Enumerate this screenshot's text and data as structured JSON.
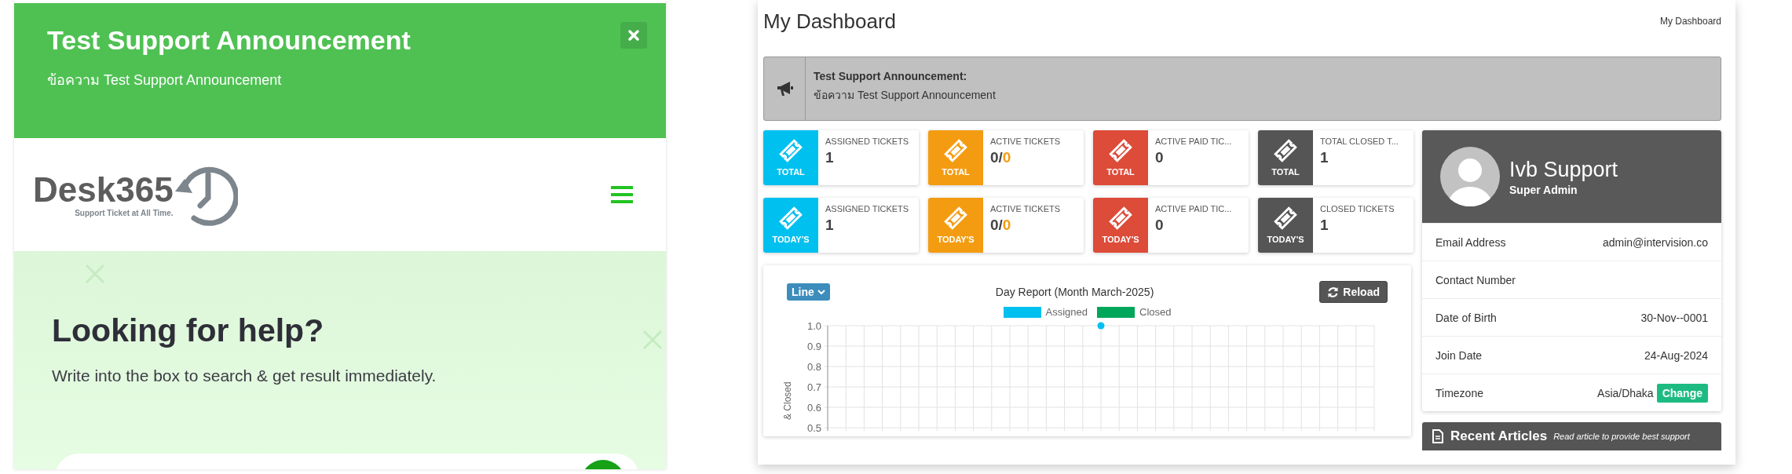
{
  "announcement_popup": {
    "title": "Test Support Announcement",
    "message": "ข้อความ Test Support Announcement"
  },
  "site_header": {
    "logo_text": "Desk365",
    "logo_tagline": "Support Ticket at All Time."
  },
  "hero": {
    "heading": "Looking for help?",
    "subheading": "Write into the box to search & get result immediately."
  },
  "dashboard": {
    "title": "My Dashboard",
    "breadcrumb": "My Dashboard"
  },
  "announcement_bar": {
    "title": "Test Support Announcement:",
    "message": "ข้อความ Test Support Announcement"
  },
  "stat_cards": [
    {
      "period": "TOTAL",
      "label": "ASSIGNED TICKETS",
      "value": "1",
      "color": "#00c0ef"
    },
    {
      "period": "TOTAL",
      "label": "ACTIVE TICKETS",
      "value": "0/",
      "value_highlight": "0",
      "color": "#f39c12"
    },
    {
      "period": "TOTAL",
      "label": "ACTIVE PAID TIC...",
      "value": "0",
      "color": "#dd4b39"
    },
    {
      "period": "TOTAL",
      "label": "TOTAL CLOSED T...",
      "value": "1",
      "color": "#555555"
    },
    {
      "period": "TODAY'S",
      "label": "ASSIGNED TICKETS",
      "value": "1",
      "color": "#00c0ef"
    },
    {
      "period": "TODAY'S",
      "label": "ACTIVE TICKETS",
      "value": "0/",
      "value_highlight": "0",
      "color": "#f39c12"
    },
    {
      "period": "TODAY'S",
      "label": "ACTIVE PAID TIC...",
      "value": "0",
      "color": "#dd4b39"
    },
    {
      "period": "TODAY'S",
      "label": "CLOSED TICKETS",
      "value": "1",
      "color": "#555555"
    }
  ],
  "chart_panel": {
    "chart_type_button": "Line",
    "reload_button": "Reload",
    "chart_data": {
      "type": "line",
      "title": "Day Report (Month March-2025)",
      "ylabel": "& Closed",
      "ylim": [
        0.5,
        1.0
      ],
      "yticks": [
        {
          "value": 1.0,
          "label": "1.0"
        },
        {
          "value": 0.9,
          "label": "0.9"
        },
        {
          "value": 0.8,
          "label": "0.8"
        },
        {
          "value": 0.7,
          "label": "0.7"
        },
        {
          "value": 0.6,
          "label": "0.6"
        },
        {
          "value": 0.5,
          "label": "0.5"
        }
      ],
      "series": [
        {
          "name": "Assigned",
          "color": "#00c0ef",
          "marker": true,
          "values": [
            null,
            null,
            null,
            null,
            null,
            null,
            null,
            null,
            null,
            null,
            null,
            null,
            null,
            null,
            null,
            1,
            null,
            null,
            null,
            null,
            null,
            null,
            null,
            null,
            null,
            null,
            null,
            null,
            null,
            null,
            null
          ]
        },
        {
          "name": "Closed",
          "color": "#00a65a",
          "values": [
            null,
            null,
            null,
            null,
            null,
            null,
            null,
            null,
            null,
            null,
            null,
            null,
            null,
            null,
            null,
            null,
            null,
            null,
            null,
            null,
            null,
            null,
            null,
            null,
            null,
            null,
            null,
            null,
            null,
            null,
            null
          ]
        }
      ],
      "grid": true
    }
  },
  "profile": {
    "name": "Ivb Support",
    "role": "Super Admin",
    "fields": [
      {
        "label": "Email Address",
        "value": "admin@intervision.co"
      },
      {
        "label": "Contact Number"
      },
      {
        "label": "Date of Birth",
        "value": "30-Nov--0001"
      },
      {
        "label": "Join Date",
        "value": "24-Aug-2024"
      },
      {
        "label": "Timezone",
        "value": "Asia/Dhaka",
        "action": "Change"
      }
    ]
  },
  "recent_articles": {
    "title": "Recent Articles",
    "subtitle": "Read article to provide best support"
  }
}
